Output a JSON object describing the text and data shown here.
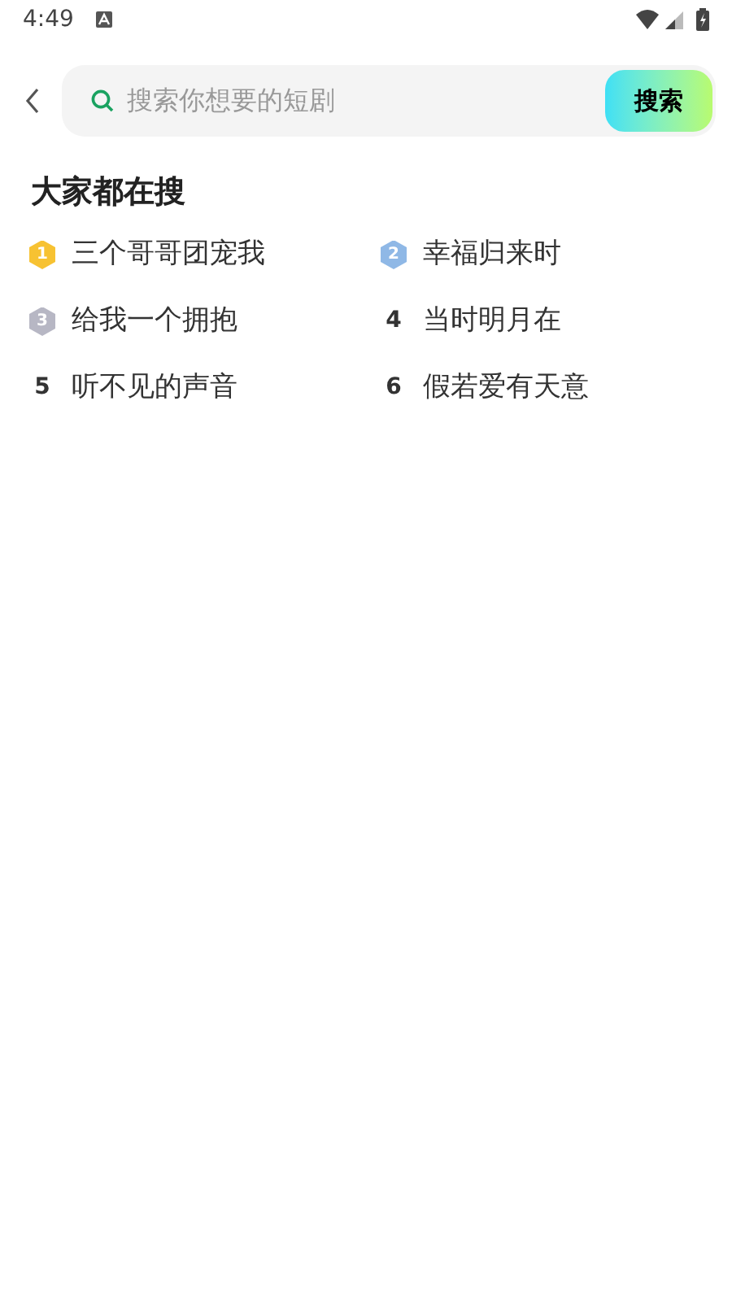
{
  "status_bar": {
    "time": "4:49"
  },
  "search": {
    "placeholder": "搜索你想要的短剧",
    "button": "搜索"
  },
  "section_title": "大家都在搜",
  "items": [
    {
      "rank": "1",
      "kind": "badge",
      "color": "#f7c232",
      "title": "三个哥哥团宠我"
    },
    {
      "rank": "2",
      "kind": "badge",
      "color": "#8fb8e6",
      "title": "幸福归来时"
    },
    {
      "rank": "3",
      "kind": "badge",
      "color": "#b7b7c4",
      "title": "给我一个拥抱"
    },
    {
      "rank": "4",
      "kind": "plain",
      "title": "当时明月在"
    },
    {
      "rank": "5",
      "kind": "plain",
      "title": "听不见的声音"
    },
    {
      "rank": "6",
      "kind": "plain",
      "title": "假若爱有天意"
    }
  ]
}
